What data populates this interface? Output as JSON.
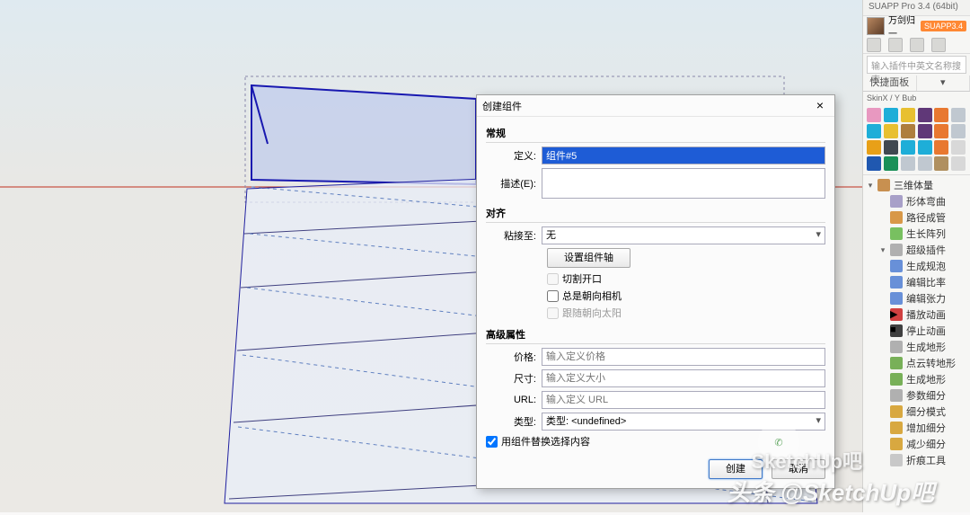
{
  "app_title": "SUAPP Pro 3.4 (64bit)",
  "user": "万剑归一",
  "badge": "SUAPP3.4",
  "search_placeholder": "输入插件中英文名称搜索",
  "panel_tab": "快捷面板",
  "dialog": {
    "title": "创建组件",
    "section_general": "常规",
    "lab_def": "定义:",
    "val_def": "组件#5",
    "lab_desc": "描述(E):",
    "section_align": "对齐",
    "lab_glue": "粘接至:",
    "val_glue": "无",
    "btn_axes": "设置组件轴",
    "chk_cut": "切割开口",
    "chk_cam": "总是朝向相机",
    "chk_sun": "跟随朝向太阳",
    "section_adv": "高级属性",
    "lab_price": "价格:",
    "ph_price": "输入定义价格",
    "lab_size": "尺寸:",
    "ph_size": "输入定义大小",
    "lab_url": "URL:",
    "ph_url": "输入定义 URL",
    "lab_type": "类型:",
    "val_type": "类型: <undefined>",
    "chk_replace": "用组件替换选择内容",
    "btn_create": "创建",
    "btn_cancel": "取消"
  },
  "tree": [
    {
      "label": "三维体量",
      "icon": "#c89050",
      "exp": true,
      "top": true
    },
    {
      "label": "形体弯曲",
      "icon": "#a8a0c8",
      "ind": true
    },
    {
      "label": "路径成管",
      "icon": "#d89848",
      "ind": true
    },
    {
      "label": "生长阵列",
      "icon": "#78c060",
      "ind": true
    },
    {
      "label": "超级插件",
      "icon": "#b0b0b0",
      "ind": true,
      "exp": true
    },
    {
      "label": "生成规泡",
      "icon": "#6890d8",
      "ind": true
    },
    {
      "label": "编辑比率",
      "icon": "#6890d8",
      "ind": true
    },
    {
      "label": "编辑张力",
      "icon": "#6890d8",
      "ind": true
    },
    {
      "label": "播放动画",
      "icon": "#d04040",
      "ind": true,
      "badge": "▶"
    },
    {
      "label": "停止动画",
      "icon": "#404040",
      "ind": true,
      "badge": "■"
    },
    {
      "label": "生成地形",
      "icon": "#b0b0b0",
      "ind": true
    },
    {
      "label": "点云转地形",
      "icon": "#78b058",
      "ind": true
    },
    {
      "label": "生成地形",
      "icon": "#78b058",
      "ind": true
    },
    {
      "label": "参数细分",
      "icon": "#b0b0b0",
      "ind": true
    },
    {
      "label": "细分模式",
      "icon": "#d8a840",
      "ind": true
    },
    {
      "label": "增加细分",
      "icon": "#d8a840",
      "ind": true
    },
    {
      "label": "减少细分",
      "icon": "#d8a840",
      "ind": true
    },
    {
      "label": "折痕工具",
      "icon": "#c8c8c8",
      "ind": true
    }
  ],
  "palette": [
    "#e898c0",
    "#1eaed8",
    "#e8c030",
    "#603878",
    "#e87830",
    "#c0c8d0",
    "#1eaed8",
    "#e8c030",
    "#ae7e3e",
    "#603878",
    "#e87830",
    "#c0c8d0",
    "#e8a018",
    "#404850",
    "#1eaed8",
    "#1eaed8",
    "#e87830",
    "#d8d8d8",
    "#2058b0",
    "#1a9058",
    "#c0c8d0",
    "#c0c8d0",
    "#b09060",
    "#d8d8d8"
  ],
  "watermark_small": "SketchUp吧",
  "watermark": "头条 @SketchUp吧"
}
